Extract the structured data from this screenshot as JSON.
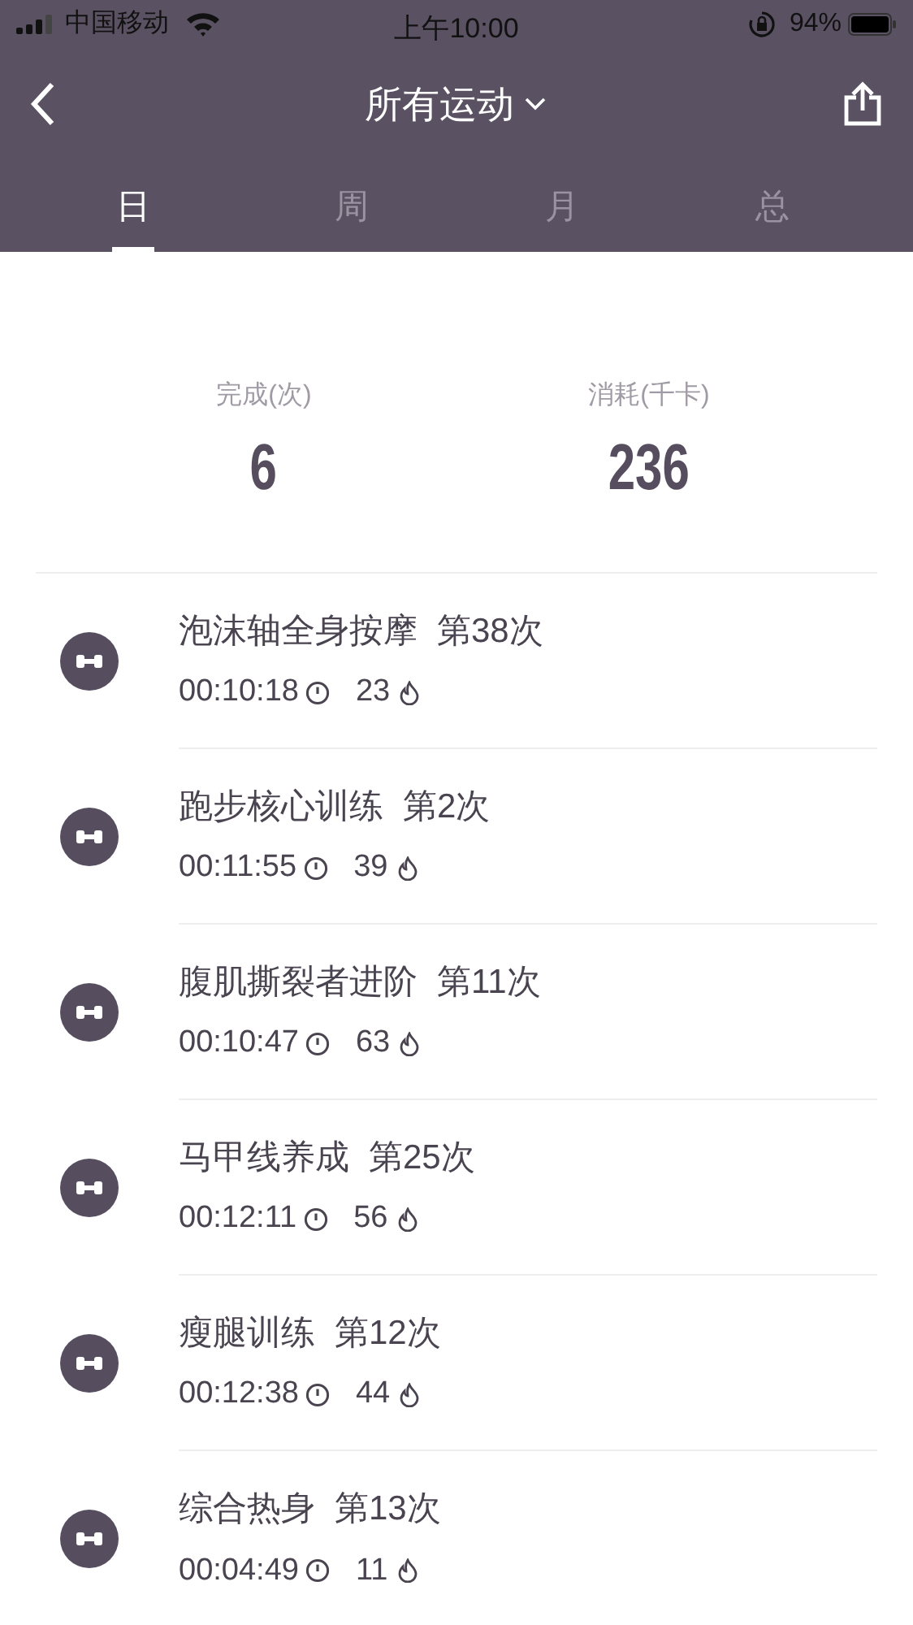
{
  "status_bar": {
    "carrier": "中国移动",
    "time": "上午10:00",
    "battery": "94%"
  },
  "nav": {
    "title": "所有运动"
  },
  "tabs": [
    {
      "label": "日",
      "selected": true
    },
    {
      "label": "周",
      "selected": false
    },
    {
      "label": "月",
      "selected": false
    },
    {
      "label": "总",
      "selected": false
    }
  ],
  "summary": {
    "stats": [
      {
        "label": "完成(次)",
        "value": "6"
      },
      {
        "label": "消耗(千卡)",
        "value": "236"
      }
    ]
  },
  "workouts": [
    {
      "name": "泡沫轴全身按摩",
      "count": "第38次",
      "duration": "00:10:18",
      "calories": "23"
    },
    {
      "name": "跑步核心训练",
      "count": "第2次",
      "duration": "00:11:55",
      "calories": "39"
    },
    {
      "name": "腹肌撕裂者进阶",
      "count": "第11次",
      "duration": "00:10:47",
      "calories": "63"
    },
    {
      "name": "马甲线养成",
      "count": "第25次",
      "duration": "00:12:11",
      "calories": "56"
    },
    {
      "name": "瘦腿训练",
      "count": "第12次",
      "duration": "00:12:38",
      "calories": "44"
    },
    {
      "name": "综合热身",
      "count": "第13次",
      "duration": "00:04:49",
      "calories": "11"
    }
  ]
}
